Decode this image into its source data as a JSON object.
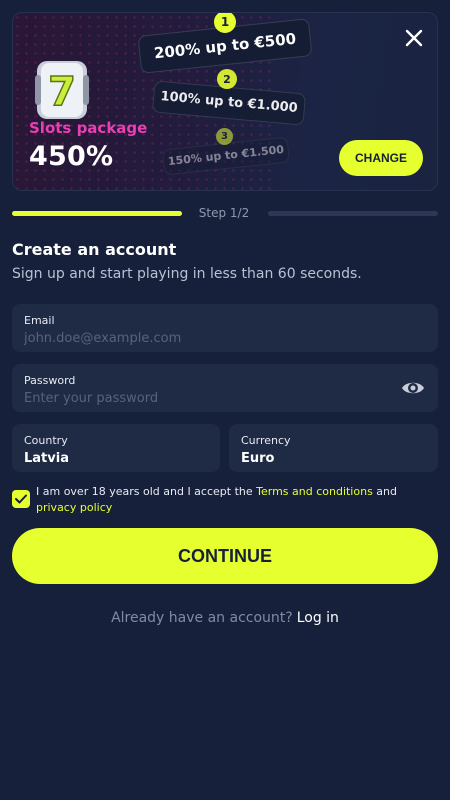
{
  "banner": {
    "package_label": "Slots package",
    "package_value": "450%",
    "offers": [
      {
        "number": "1",
        "text": "200% up to €500"
      },
      {
        "number": "2",
        "text": "100% up to €1.000"
      },
      {
        "number": "3",
        "text": "150% up to €1.500"
      }
    ],
    "change_label": "CHANGE",
    "icons": {
      "close": "close-icon",
      "slot": "slot-machine-icon"
    },
    "slot_glyph": "7"
  },
  "progress": {
    "step_label": "Step 1/2",
    "current_step": 1,
    "total_steps": 2
  },
  "form": {
    "title": "Create an account",
    "subtitle": "Sign up and start playing in less than 60 seconds.",
    "email": {
      "label": "Email",
      "placeholder": "john.doe@example.com",
      "value": ""
    },
    "password": {
      "label": "Password",
      "placeholder": "Enter your password",
      "value": "",
      "toggle_icon": "eye-icon"
    },
    "country": {
      "label": "Country",
      "value": "Latvia"
    },
    "currency": {
      "label": "Currency",
      "value": "Euro"
    },
    "terms": {
      "checked": true,
      "text_before": "I am over 18 years old and I accept the ",
      "terms_link": "Terms and conditions",
      "text_middle": " and ",
      "privacy_link": "privacy policy"
    },
    "continue_label": "CONTINUE"
  },
  "footer": {
    "prompt": "Already have an account?",
    "login_link": "Log in"
  },
  "colors": {
    "accent": "#e6ff2f",
    "background": "#16203a",
    "field_bg": "#1f2a44",
    "package_label": "#e93fb2"
  }
}
